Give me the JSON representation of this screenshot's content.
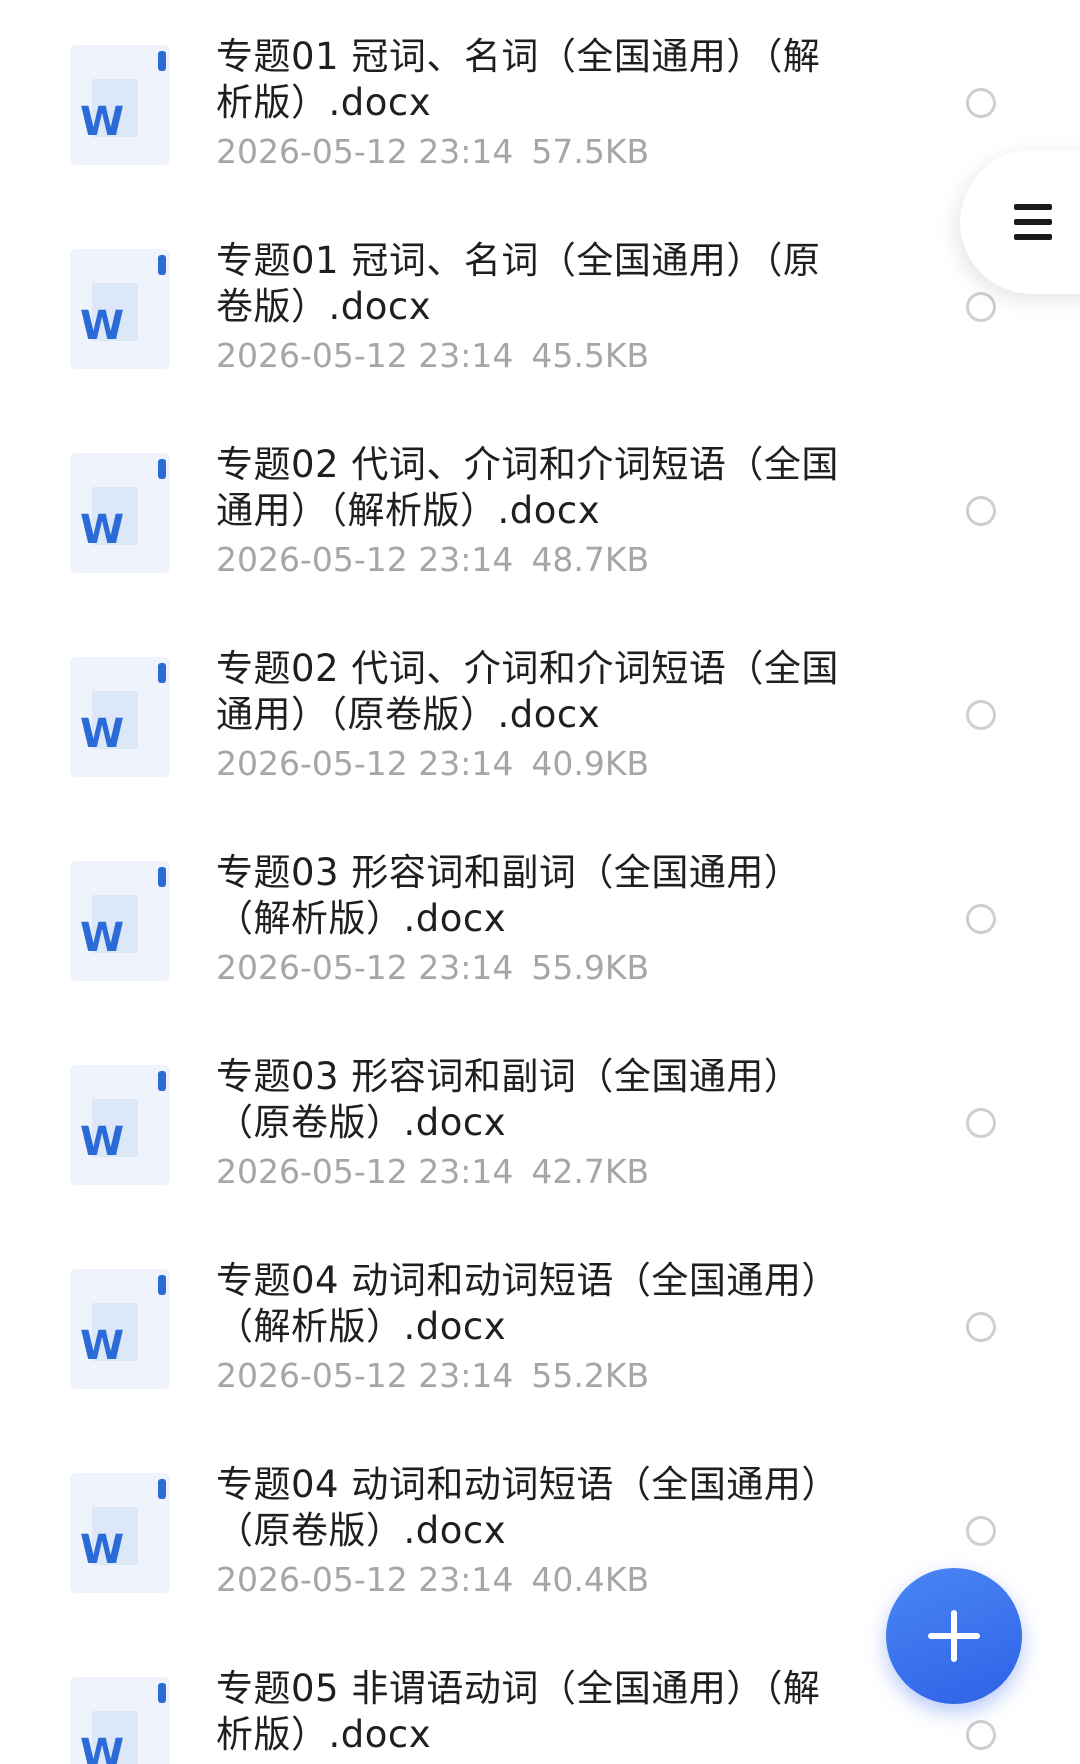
{
  "files": [
    {
      "name": "专题01 冠词、名词（全国通用）（解析版）.docx",
      "date": "2026-05-12 23:14",
      "size": "57.5KB",
      "selected": false
    },
    {
      "name": "专题01 冠词、名词（全国通用）（原卷版）.docx",
      "date": "2026-05-12 23:14",
      "size": "45.5KB",
      "selected": false
    },
    {
      "name": "专题02 代词、介词和介词短语（全国通用）（解析版）.docx",
      "date": "2026-05-12 23:14",
      "size": "48.7KB",
      "selected": false
    },
    {
      "name": "专题02 代词、介词和介词短语（全国通用）（原卷版）.docx",
      "date": "2026-05-12 23:14",
      "size": "40.9KB",
      "selected": false
    },
    {
      "name": "专题03 形容词和副词（全国通用）（解析版）.docx",
      "date": "2026-05-12 23:14",
      "size": "55.9KB",
      "selected": false
    },
    {
      "name": "专题03 形容词和副词（全国通用）（原卷版）.docx",
      "date": "2026-05-12 23:14",
      "size": "42.7KB",
      "selected": false
    },
    {
      "name": "专题04 动词和动词短语（全国通用）（解析版）.docx",
      "date": "2026-05-12 23:14",
      "size": "55.2KB",
      "selected": false
    },
    {
      "name": "专题04 动词和动词短语（全国通用）（原卷版）.docx",
      "date": "2026-05-12 23:14",
      "size": "40.4KB",
      "selected": false
    },
    {
      "name": "专题05 非谓语动词（全国通用）（解析版）.docx",
      "date": "",
      "size": "",
      "selected": false
    }
  ],
  "icons": {
    "file": "word-doc-icon",
    "menu": "hamburger-menu-icon",
    "fab": "plus-icon"
  },
  "colors": {
    "word_blue": "#2a6bd8",
    "fab_blue": "#3a72ee",
    "meta_gray": "#a6a6a6",
    "radio_border": "#cfcfcf"
  }
}
